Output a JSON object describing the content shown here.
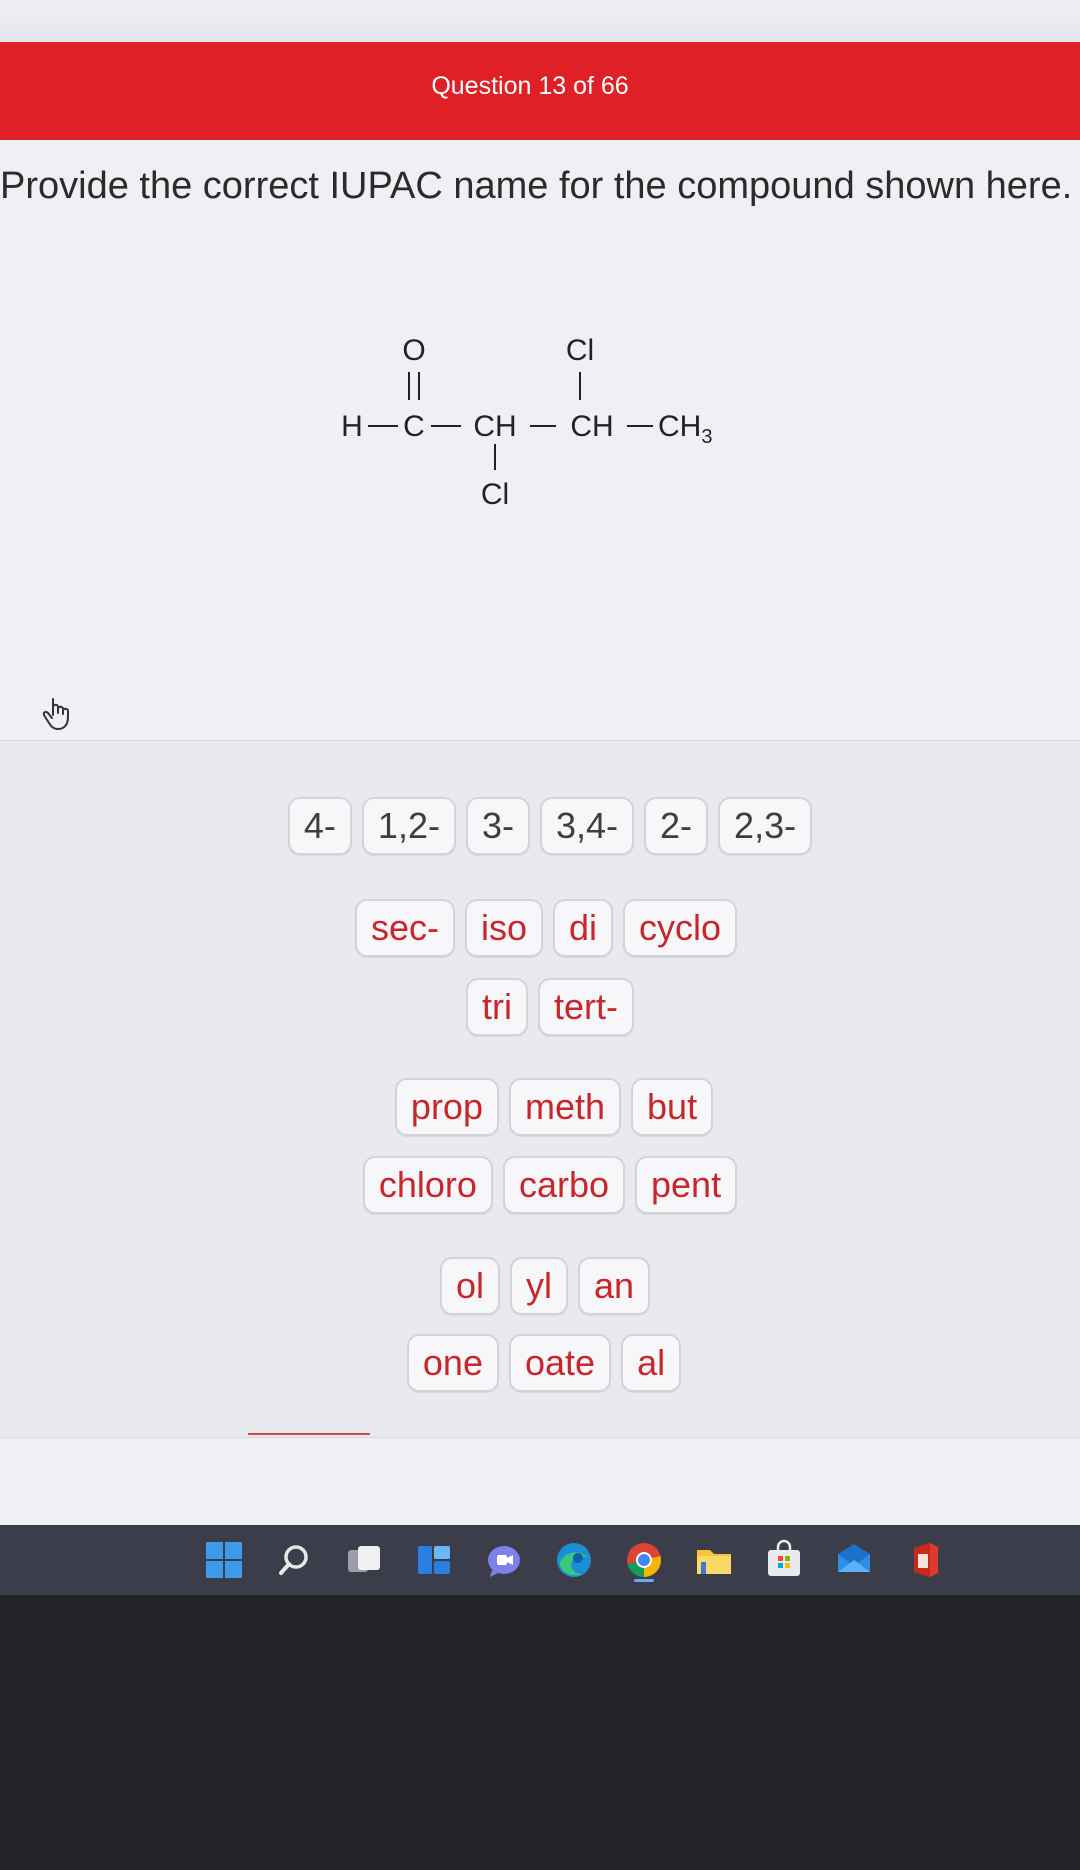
{
  "header": {
    "title": "Question 13 of 66",
    "color": "#df2027"
  },
  "question": {
    "prompt": "Provide the correct IUPAC name for the compound shown here.",
    "structure": {
      "top_o": "O",
      "top_cl": "Cl",
      "chain": [
        "H",
        "C",
        "CH",
        "CH",
        "CH3"
      ],
      "bottom_cl": "Cl"
    }
  },
  "tiles": {
    "locants": [
      "4-",
      "1,2-",
      "3-",
      "3,4-",
      "2-",
      "2,3-"
    ],
    "modifiers_row1": [
      "sec-",
      "iso",
      "di",
      "cyclo"
    ],
    "modifiers_row2": [
      "tri",
      "tert-"
    ],
    "roots_row1": [
      "prop",
      "meth",
      "but"
    ],
    "roots_row2": [
      "chloro",
      "carbo",
      "pent"
    ],
    "suffix_row1": [
      "ol",
      "yl",
      "an"
    ],
    "suffix_row2": [
      "one",
      "oate",
      "al"
    ]
  },
  "colors": {
    "tile_red": "#c8262b",
    "tile_dark": "#3e3e3e"
  },
  "taskbar_icons": [
    "windows-start-icon",
    "search-icon",
    "task-view-icon",
    "widgets-icon",
    "teams-chat-icon",
    "edge-browser-icon",
    "chrome-browser-icon",
    "file-explorer-icon",
    "microsoft-store-icon",
    "mail-icon",
    "office-icon"
  ]
}
